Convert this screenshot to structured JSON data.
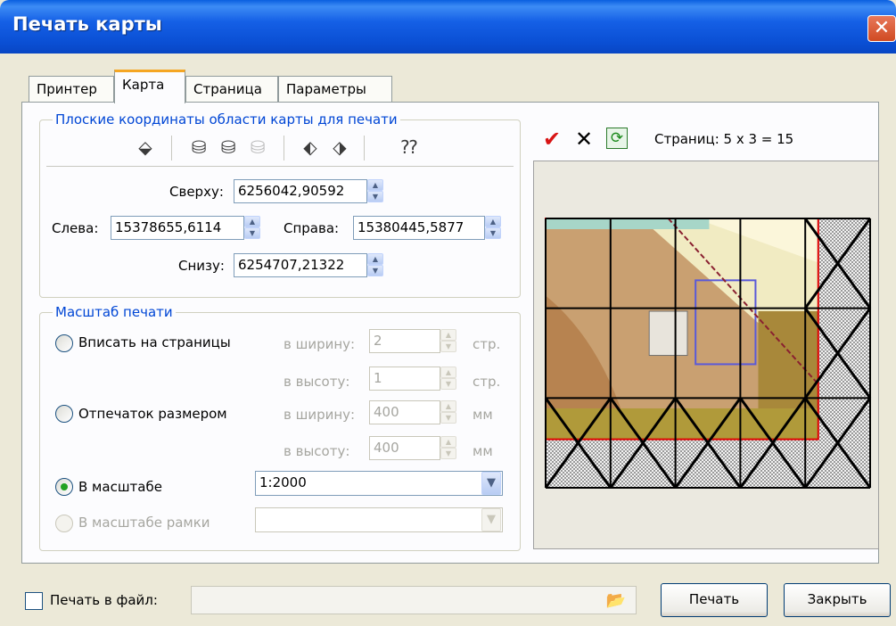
{
  "window": {
    "title": "Печать карты",
    "close_label": "✕"
  },
  "tabs": [
    {
      "label": "Принтер"
    },
    {
      "label": "Карта"
    },
    {
      "label": "Страница"
    },
    {
      "label": "Параметры"
    }
  ],
  "coords": {
    "group_title": "Плоские координаты области карты для печати",
    "top_label": "Сверху:",
    "top_value": "6256042,90592",
    "left_label": "Слева:",
    "left_value": "15378655,6114",
    "right_label": "Справа:",
    "right_value": "15380445,5877",
    "bottom_label": "Снизу:",
    "bottom_value": "6254707,21322"
  },
  "scale": {
    "group_title": "Масштаб печати",
    "fit_pages_label": "Вписать на страницы",
    "fit_width_label": "в ширину:",
    "fit_width_value": "2",
    "fit_width_unit": "стр.",
    "fit_height_label": "в высоту:",
    "fit_height_value": "1",
    "fit_height_unit": "стр.",
    "print_size_label": "Отпечаток размером",
    "size_width_label": "в ширину:",
    "size_width_value": "400",
    "size_width_unit": "мм",
    "size_height_label": "в высоту:",
    "size_height_value": "400",
    "size_height_unit": "мм",
    "in_scale_label": "В масштабе",
    "in_scale_value": "1:2000",
    "frame_scale_label": "В масштабе рамки",
    "frame_scale_value": "",
    "selected": "in_scale"
  },
  "preview": {
    "pages_text": "Страниц: 5 х 3 = 15",
    "grid_cols": 5,
    "grid_rows": 3,
    "map_coverage_x": 0.84,
    "map_coverage_y": 0.82
  },
  "footer": {
    "print_to_file_label": "Печать в файл:",
    "print_to_file_checked": false,
    "file_path": "",
    "print_button": "Печать",
    "close_button": "Закрыть"
  },
  "colors": {
    "title_bar": "#0a4fd4",
    "group_title": "#0046d5",
    "map_border": "#e00000",
    "active_tab_accent": "#f5a623"
  }
}
